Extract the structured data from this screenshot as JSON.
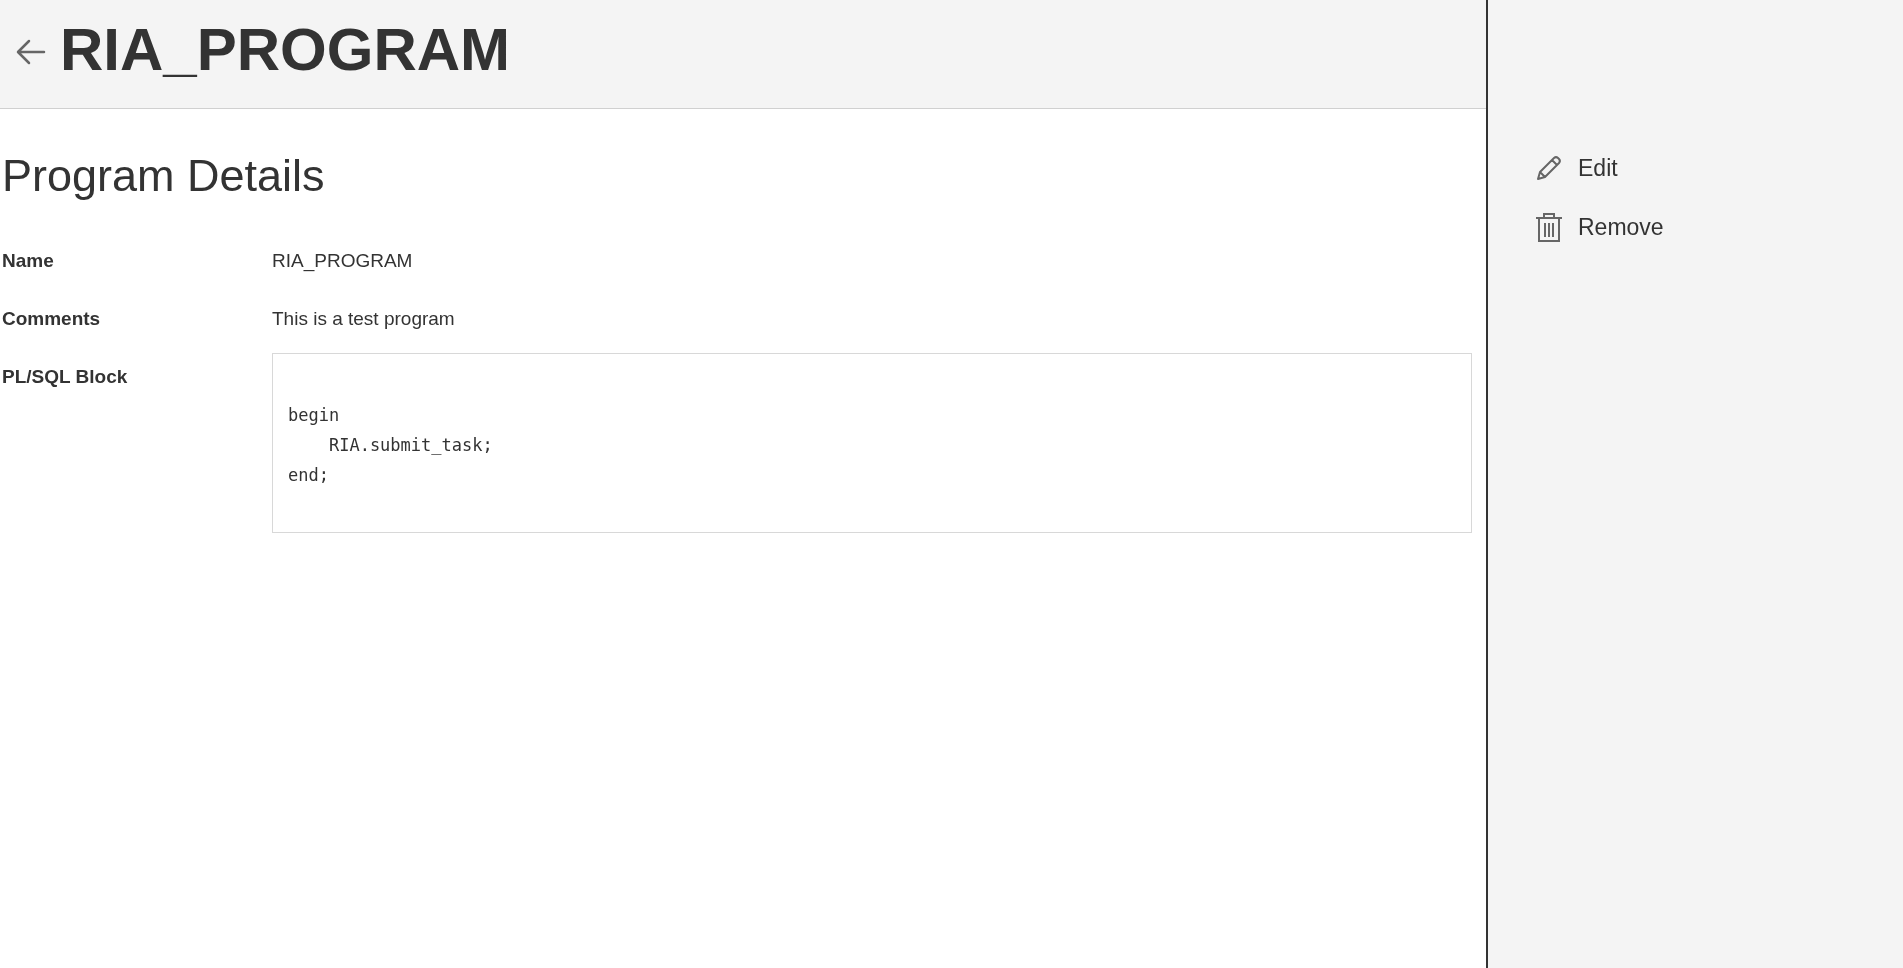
{
  "header": {
    "title": "RIA_PROGRAM"
  },
  "section_title": "Program Details",
  "fields": [
    {
      "label": "Name",
      "kind": "text",
      "value": "RIA_PROGRAM"
    },
    {
      "label": "Comments",
      "kind": "text",
      "value": "This is a test program"
    },
    {
      "label": "PL/SQL Block",
      "kind": "code",
      "lines": [
        "begin",
        "    RIA.submit_task;",
        "end;"
      ]
    }
  ],
  "actions": [
    {
      "label": "Edit",
      "kind": "edit"
    },
    {
      "label": "Remove",
      "kind": "remove"
    }
  ]
}
